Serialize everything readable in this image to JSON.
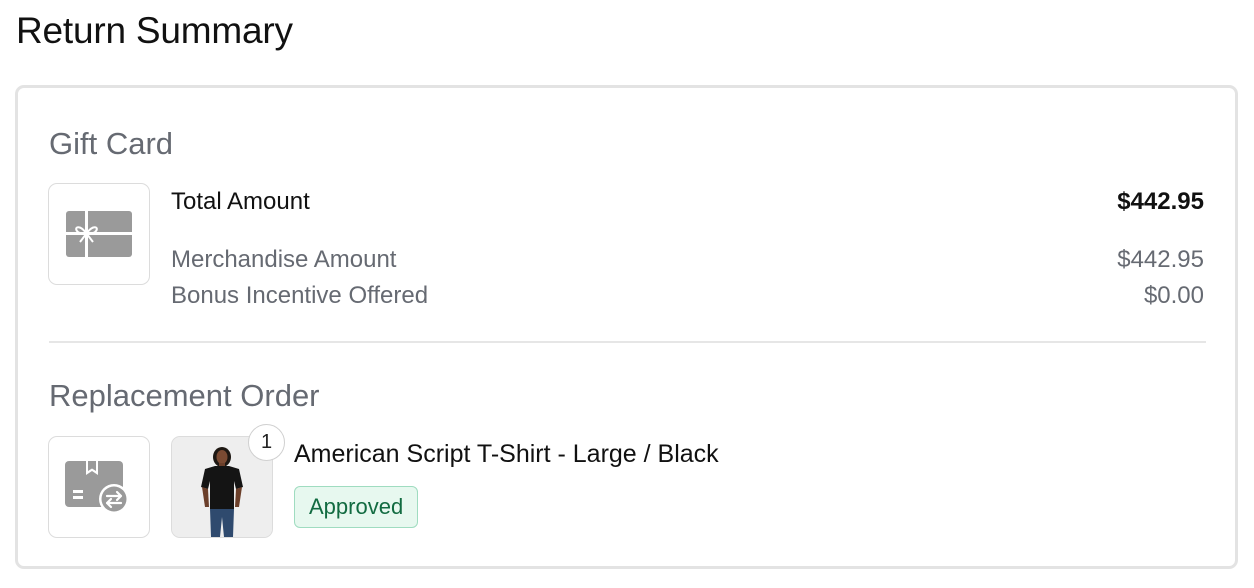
{
  "page_title": "Return Summary",
  "gift_card": {
    "section_title": "Gift Card",
    "icon": "gift-card-icon",
    "total_label": "Total Amount",
    "total_value": "$442.95",
    "merch_label": "Merchandise Amount",
    "merch_value": "$442.95",
    "bonus_label": "Bonus Incentive Offered",
    "bonus_value": "$0.00"
  },
  "replacement_order": {
    "section_title": "Replacement Order",
    "icon": "package-exchange-icon",
    "item": {
      "quantity": "1",
      "name": "American Script T-Shirt - Large / Black",
      "status": "Approved"
    }
  },
  "colors": {
    "muted_text": "#666a72",
    "icon_gray": "#9a9a9a",
    "approved_bg": "#e7f8ef",
    "approved_border": "#9fdcc0",
    "approved_text": "#126b41"
  }
}
